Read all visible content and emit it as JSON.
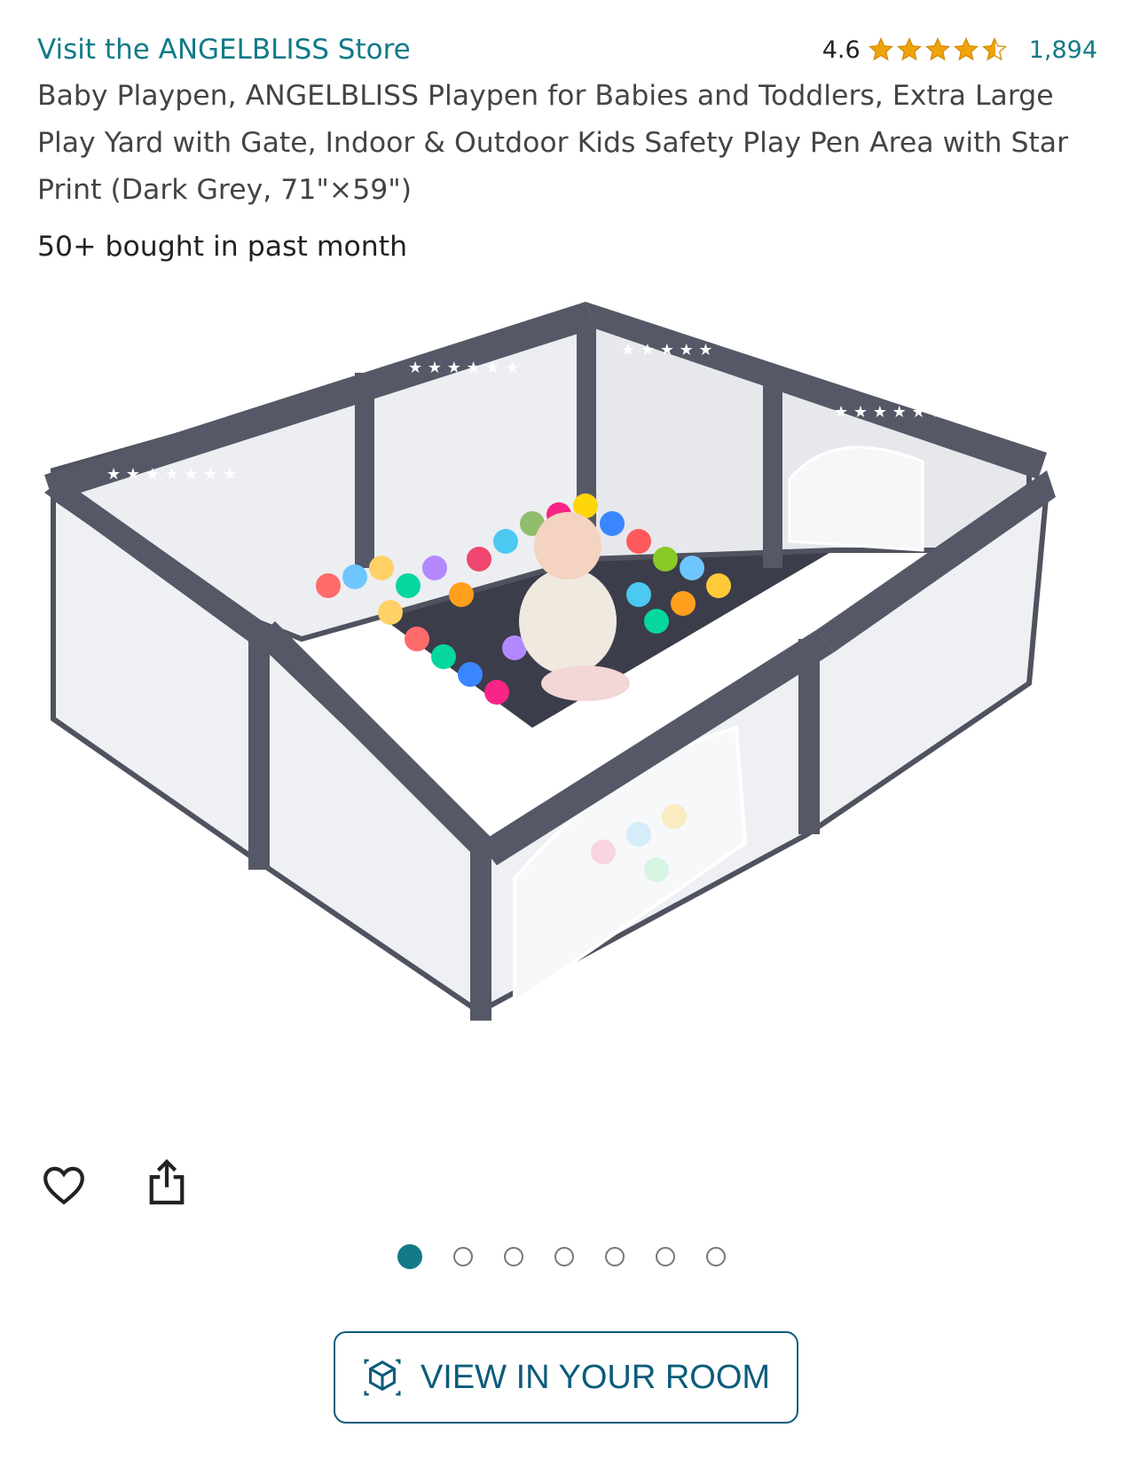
{
  "store": {
    "link_text": "Visit the ANGELBLISS Store"
  },
  "rating": {
    "value": "4.6",
    "stars": 4.6,
    "count": "1,894",
    "star_color": "#f0a30a"
  },
  "product": {
    "title": "Baby Playpen, ANGELBLISS Playpen for Babies and Toddlers, Extra Large Play Yard with Gate, Indoor & Outdoor Kids Safety Play Pen Area with Star Print (Dark Grey, 71\"×59\")",
    "purchase_stat": "50+ bought in past month",
    "image_alt": "Dark grey star-print playpen with a baby sitting among colorful balls"
  },
  "actions": {
    "favorite_icon": "heart-icon",
    "share_icon": "share-icon"
  },
  "carousel": {
    "total": 7,
    "active_index": 0,
    "active_color": "#127a87"
  },
  "ar_button": {
    "label": "VIEW IN YOUR ROOM",
    "icon": "ar-cube-icon"
  },
  "colors": {
    "link": "#127a87",
    "button_border": "#0b5c7a"
  }
}
